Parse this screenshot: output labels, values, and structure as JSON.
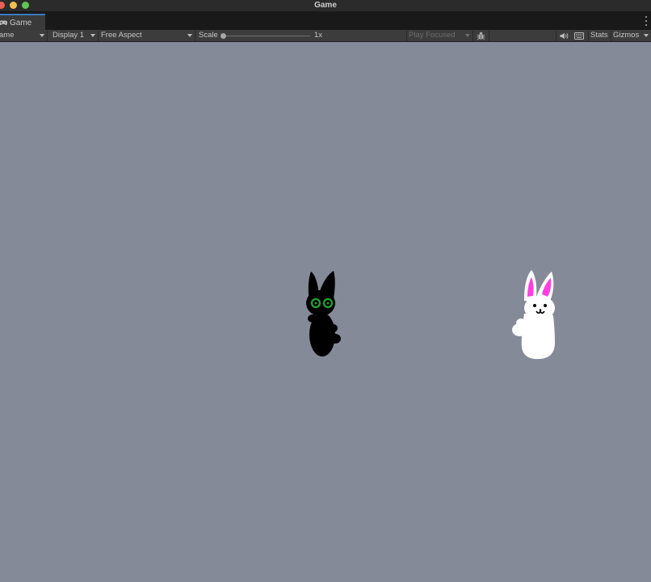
{
  "window": {
    "title": "Game"
  },
  "tab": {
    "label": "Game",
    "icon": "gamepad-icon"
  },
  "toolbar": {
    "view_dropdown": "ame",
    "display_dropdown": "Display 1",
    "aspect_dropdown": "Free Aspect",
    "scale_label": "Scale",
    "scale_value": "1x",
    "scale_level": 0,
    "play_mode_dropdown": "Play Focused",
    "stats_label": "Stats",
    "gizmos_label": "Gizmos"
  },
  "colors": {
    "viewport_bg": "#858a99",
    "tab_accent": "#3a79bb",
    "black_bunny_eyes": "#1fa82e",
    "white_bunny_ears": "#ff3ee0"
  },
  "scene": {
    "sprites": [
      {
        "name": "black-bunny",
        "fill": "#000000"
      },
      {
        "name": "white-bunny",
        "fill": "#ffffff"
      }
    ]
  }
}
